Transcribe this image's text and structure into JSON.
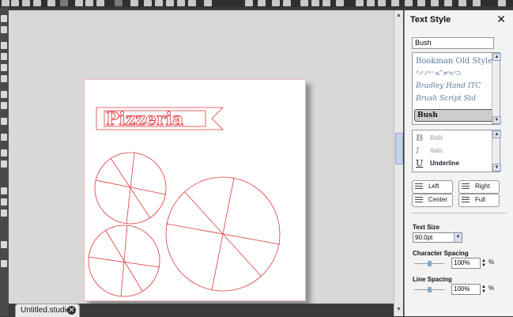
{
  "toolbar": {
    "icons": [
      "cut-icon",
      "copy-icon",
      "paste-icon",
      "print-icon",
      "undo-icon",
      "redo-icon",
      "select-icon",
      "zoom-in-icon",
      "zoom-out-icon",
      "zoom-fit-icon",
      "pan-icon",
      "send-to-cutter-icon",
      "grid-icon",
      "align-icon",
      "weld-icon",
      "offset-icon",
      "trace-icon",
      "knife-icon",
      "text-style-icon",
      "fill-color-icon",
      "line-color-icon",
      "line-style-icon",
      "pen-icon",
      "table-icon"
    ]
  },
  "document": {
    "tab_label": "Untitled.studio",
    "title_text": "Pizzeria",
    "design_color": "#e0393e"
  },
  "text_style_panel": {
    "title": "Text Style",
    "font_value": "Bush",
    "fonts": [
      {
        "name": "Bookman Old Style",
        "selected": false
      },
      {
        "name": "ᵈ↗↗ᵃ⁼≤ʺ≠≒ᵃ⊃",
        "selected": false
      },
      {
        "name": "Bradley Hand ITC",
        "selected": false
      },
      {
        "name": "Brush Script Std",
        "selected": false
      },
      {
        "name": "Bush",
        "selected": true
      }
    ],
    "styles": [
      {
        "glyph": "B",
        "label": "Bold"
      },
      {
        "glyph": "I",
        "label": "Italic"
      },
      {
        "glyph": "U",
        "label": "Underline"
      }
    ],
    "align": {
      "left": "Left",
      "right": "Right",
      "center": "Center",
      "full": "Full"
    },
    "text_size_label": "Text Size",
    "text_size_value": "90.0pt",
    "char_spacing_label": "Character Spacing",
    "char_spacing_value": "100%",
    "line_spacing_label": "Line Spacing",
    "line_spacing_value": "100%",
    "percent_sign": "%"
  }
}
